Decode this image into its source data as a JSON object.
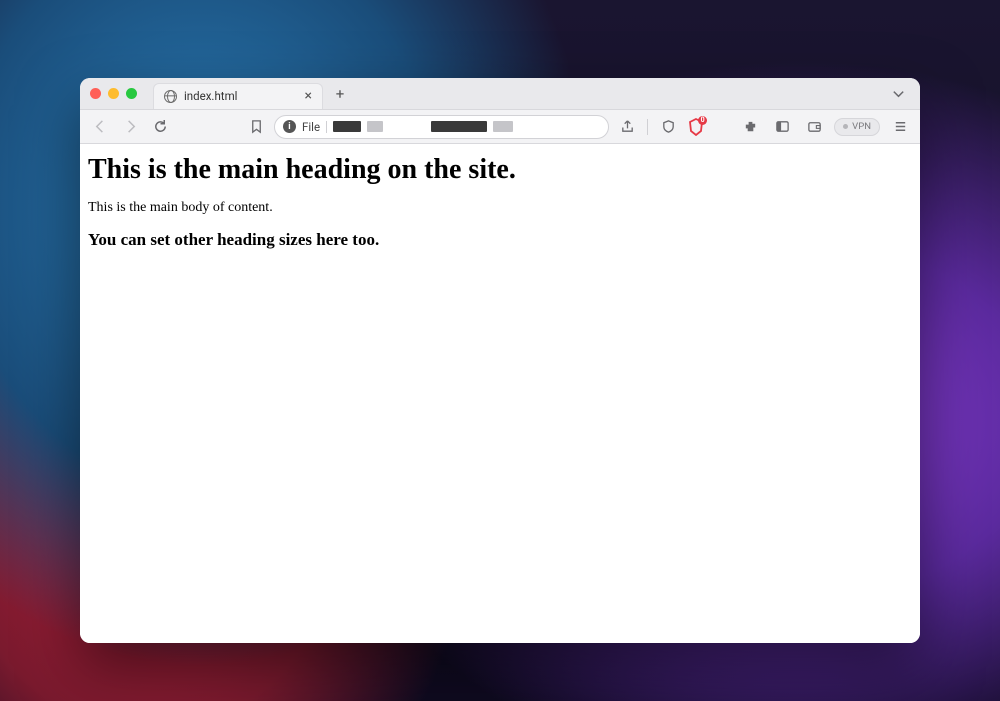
{
  "tab": {
    "title": "index.html"
  },
  "urlbar": {
    "scheme": "File"
  },
  "toolbar": {
    "vpn_label": "VPN",
    "brave_badge": "0"
  },
  "page": {
    "h1": "This is the main heading on the site.",
    "body": "This is the main body of content.",
    "h3": "You can set other heading sizes here too."
  }
}
